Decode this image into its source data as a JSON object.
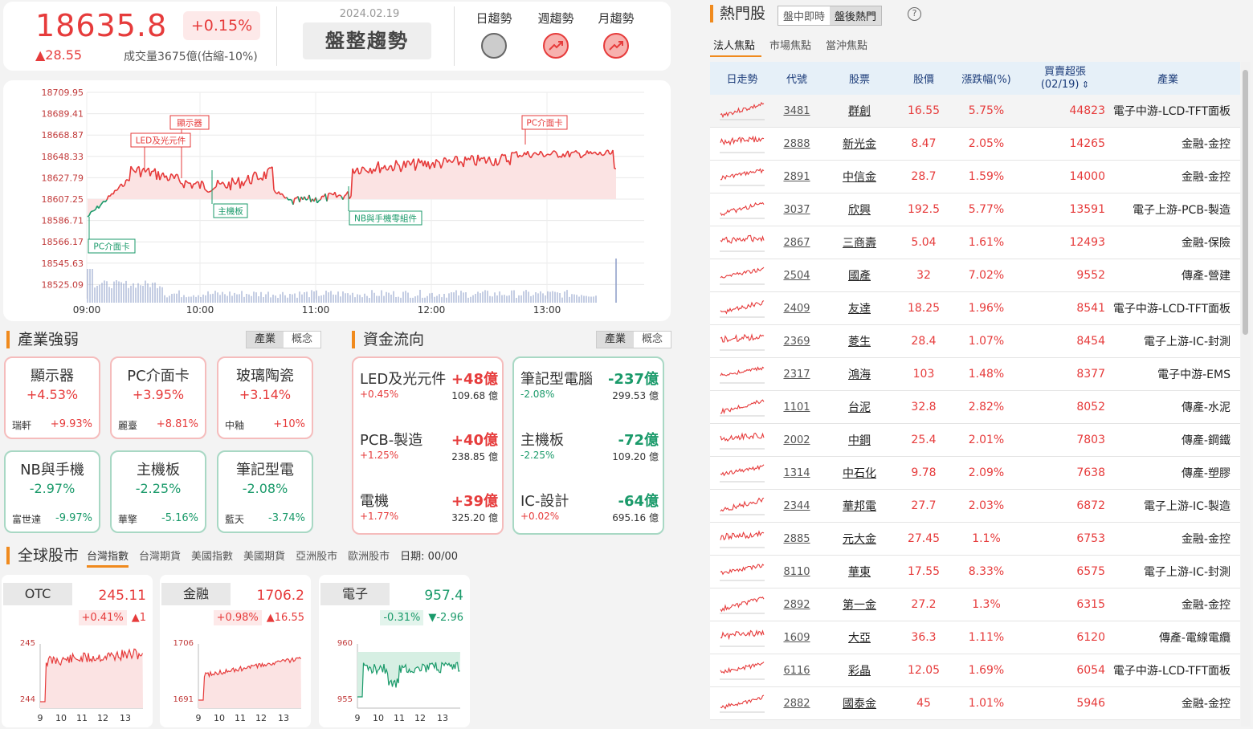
{
  "index": {
    "value": "18635.8",
    "change_pct": "+0.15%",
    "change": "▲28.55",
    "volume": "成交量3675億(估縮-10%)"
  },
  "trend": {
    "date": "2024.02.19",
    "text": "盤整趨勢",
    "items": [
      {
        "label": "日趨勢",
        "state": "flat"
      },
      {
        "label": "週趨勢",
        "state": "up"
      },
      {
        "label": "月趨勢",
        "state": "up"
      }
    ]
  },
  "main_chart": {
    "y_ticks": [
      "18709.95",
      "18689.41",
      "18668.87",
      "18648.33",
      "18627.79",
      "18607.25",
      "18586.71",
      "18566.17",
      "18545.63",
      "18525.09"
    ],
    "x_ticks": [
      "09:00",
      "10:00",
      "11:00",
      "12:00",
      "13:00"
    ],
    "annotations": [
      "顯示器",
      "LED及光元件",
      "PC介面卡",
      "主機板",
      "NB與手機零組件",
      "PC介面卡"
    ]
  },
  "industry": {
    "title": "產業強弱",
    "tabs": [
      "產業",
      "概念"
    ],
    "cards": [
      {
        "name": "顯示器",
        "pct": "+4.53%",
        "stock": "瑞軒",
        "stock_pct": "+9.93%",
        "up": true
      },
      {
        "name": "PC介面卡",
        "pct": "+3.95%",
        "stock": "麗臺",
        "stock_pct": "+8.81%",
        "up": true
      },
      {
        "name": "玻璃陶瓷",
        "pct": "+3.14%",
        "stock": "中釉",
        "stock_pct": "+10%",
        "up": true
      },
      {
        "name": "NB與手機",
        "pct": "-2.97%",
        "stock": "富世達",
        "stock_pct": "-9.97%",
        "up": false
      },
      {
        "name": "主機板",
        "pct": "-2.25%",
        "stock": "華擎",
        "stock_pct": "-5.16%",
        "up": false
      },
      {
        "name": "筆記型電",
        "pct": "-2.08%",
        "stock": "藍天",
        "stock_pct": "-3.74%",
        "up": false
      }
    ]
  },
  "flow": {
    "title": "資金流向",
    "tabs": [
      "產業",
      "概念"
    ],
    "inflow": [
      {
        "name": "LED及光元件",
        "amt": "+48億",
        "pct": "+0.45%",
        "vol": "109.68 億"
      },
      {
        "name": "PCB-製造",
        "amt": "+40億",
        "pct": "+1.25%",
        "vol": "238.85 億"
      },
      {
        "name": "電機",
        "amt": "+39億",
        "pct": "+1.77%",
        "vol": "325.20 億"
      }
    ],
    "outflow": [
      {
        "name": "筆記型電腦",
        "amt": "-237億",
        "pct": "-2.08%",
        "vol": "299.53 億"
      },
      {
        "name": "主機板",
        "amt": "-72億",
        "pct": "-2.25%",
        "vol": "109.20 億"
      },
      {
        "name": "IC-設計",
        "amt": "-64億",
        "pct": "+0.02%",
        "vol": "695.16 億"
      }
    ]
  },
  "global": {
    "title": "全球股市",
    "tabs": [
      "台灣指數",
      "台灣期貨",
      "美國指數",
      "美國期貨",
      "亞洲股市",
      "歐洲股市"
    ],
    "date": "日期: 00/00",
    "cards": [
      {
        "name": "OTC",
        "value": "245.11",
        "pct": "+0.41%",
        "chg": "▲1",
        "up": true,
        "ytop": "245",
        "ybot": "244",
        "xt": [
          "9",
          "10",
          "11",
          "12",
          "13"
        ]
      },
      {
        "name": "金融",
        "value": "1706.2",
        "pct": "+0.98%",
        "chg": "▲16.55",
        "up": true,
        "ytop": "1706",
        "ybot": "1691",
        "xt": [
          "9",
          "10",
          "11",
          "12",
          "13"
        ]
      },
      {
        "name": "電子",
        "value": "957.4",
        "pct": "-0.31%",
        "chg": "▼-2.96",
        "up": false,
        "ytop": "960",
        "ybot": "955",
        "xt": [
          "9",
          "10",
          "11",
          "12",
          "13"
        ]
      }
    ]
  },
  "hot": {
    "title": "熱門股",
    "seg": [
      "盤中即時",
      "盤後熱門"
    ],
    "help": "?",
    "subtabs": [
      "法人焦點",
      "市場焦點",
      "當沖焦點"
    ],
    "headers": [
      "日走勢",
      "代號",
      "股票",
      "股價",
      "漲跌幅(%)",
      "買賣超張\n(02/19)",
      "產業"
    ],
    "rows": [
      [
        "3481",
        "群創",
        "16.55",
        "5.75%",
        "44823",
        "電子中游-LCD-TFT面板"
      ],
      [
        "2888",
        "新光金",
        "8.47",
        "2.05%",
        "14265",
        "金融-金控"
      ],
      [
        "2891",
        "中信金",
        "28.7",
        "1.59%",
        "14000",
        "金融-金控"
      ],
      [
        "3037",
        "欣興",
        "192.5",
        "5.77%",
        "13591",
        "電子上游-PCB-製造"
      ],
      [
        "2867",
        "三商壽",
        "5.04",
        "1.61%",
        "12493",
        "金融-保險"
      ],
      [
        "2504",
        "國產",
        "32",
        "7.02%",
        "9552",
        "傳產-營建"
      ],
      [
        "2409",
        "友達",
        "18.25",
        "1.96%",
        "8541",
        "電子中游-LCD-TFT面板"
      ],
      [
        "2369",
        "菱生",
        "28.4",
        "1.07%",
        "8454",
        "電子上游-IC-封測"
      ],
      [
        "2317",
        "鴻海",
        "103",
        "1.48%",
        "8377",
        "電子中游-EMS"
      ],
      [
        "1101",
        "台泥",
        "32.8",
        "2.82%",
        "8052",
        "傳產-水泥"
      ],
      [
        "2002",
        "中鋼",
        "25.4",
        "2.01%",
        "7803",
        "傳產-鋼鐵"
      ],
      [
        "1314",
        "中石化",
        "9.78",
        "2.09%",
        "7638",
        "傳產-塑膠"
      ],
      [
        "2344",
        "華邦電",
        "27.7",
        "2.03%",
        "6872",
        "電子上游-IC-製造"
      ],
      [
        "2885",
        "元大金",
        "27.45",
        "1.1%",
        "6753",
        "金融-金控"
      ],
      [
        "8110",
        "華東",
        "17.55",
        "8.33%",
        "6575",
        "電子上游-IC-封測"
      ],
      [
        "2892",
        "第一金",
        "27.2",
        "1.3%",
        "6315",
        "金融-金控"
      ],
      [
        "1609",
        "大亞",
        "36.3",
        "1.11%",
        "6120",
        "傳產-電線電纜"
      ],
      [
        "6116",
        "彩晶",
        "12.05",
        "1.69%",
        "6054",
        "電子中游-LCD-TFT面板"
      ],
      [
        "2882",
        "國泰金",
        "45",
        "1.01%",
        "5946",
        "金融-金控"
      ]
    ]
  },
  "colors": {
    "up": "#e63b3b",
    "down": "#1a9a6a",
    "accent": "#f08a1d"
  }
}
